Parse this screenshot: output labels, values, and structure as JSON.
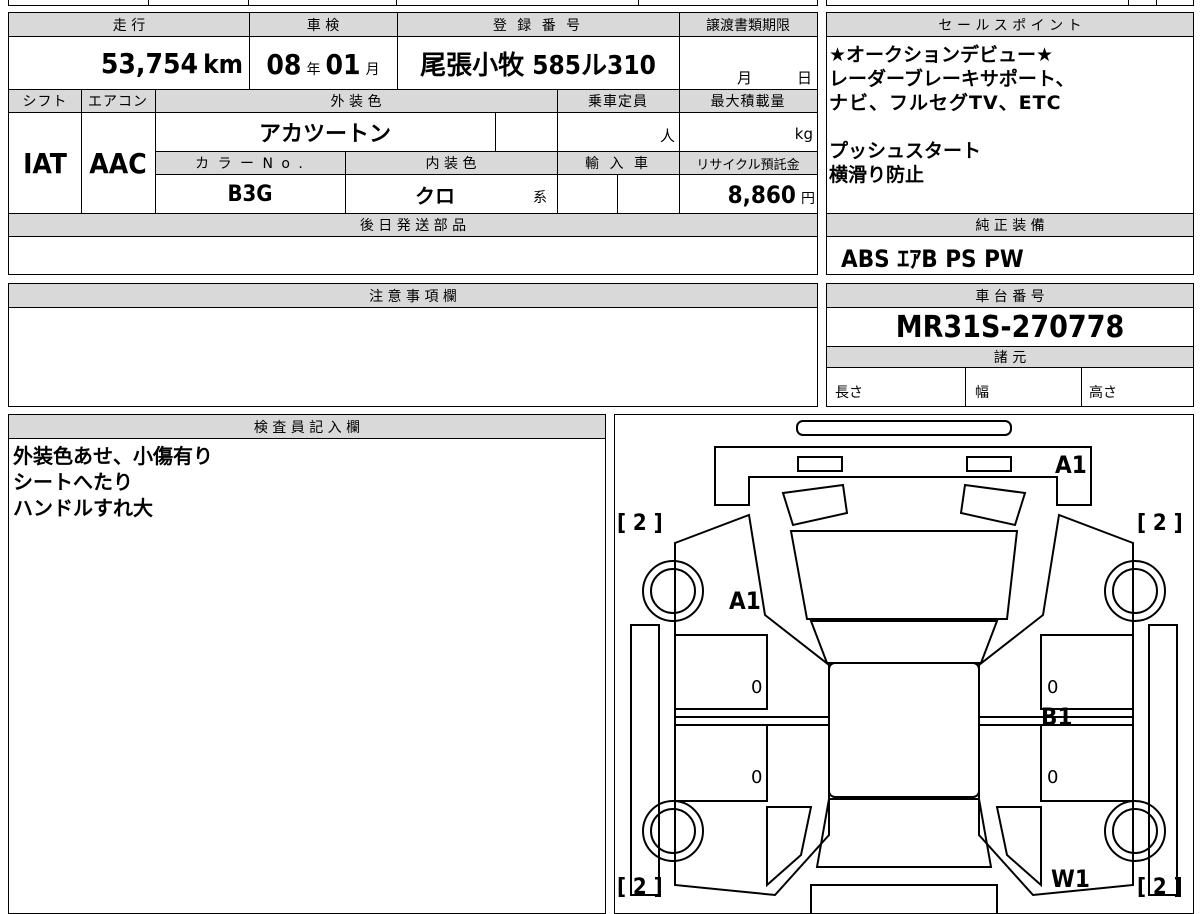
{
  "top": {
    "mileage_label": "走 行",
    "mileage_value": "53,754",
    "mileage_unit": "km",
    "shaken_label": "車 検",
    "shaken_year": "08",
    "shaken_year_unit": "年",
    "shaken_month": "01",
    "shaken_month_unit": "月",
    "reg_label": "登 録 番 号",
    "reg_value": "尾張小牧 585ル310",
    "transfer_label": "譲渡書類期限",
    "transfer_month_unit": "月",
    "transfer_day_unit": "日"
  },
  "row2": {
    "shift_label": "シフト",
    "aircon_label": "エアコン",
    "exterior_label": "外 装 色",
    "capacity_label": "乗車定員",
    "maxload_label": "最大積載量",
    "shift_value": "IAT",
    "aircon_value": "AAC",
    "exterior_value": "アカツートン",
    "capacity_unit": "人",
    "maxload_unit": "kg",
    "colorno_label": "カ ラ ー N o .",
    "interior_label": "内 装 色",
    "import_label": "輸 入 車",
    "recycle_label": "リサイクル預託金",
    "colorno_value": "B3G",
    "interior_value": "クロ",
    "interior_suffix": "系",
    "recycle_value": "8,860",
    "recycle_unit": "円"
  },
  "later_parts": {
    "label": "後 日 発 送 部 品"
  },
  "notes": {
    "label": "注 意 事 項 欄"
  },
  "inspector": {
    "label": "検 査 員 記 入 欄",
    "lines": [
      "外装色あせ、小傷有り",
      "シートへたり",
      "ハンドルすれ大"
    ]
  },
  "sales_point": {
    "label": "セ ー ル ス ポ イ ン ト",
    "lines": [
      "★オークションデビュー★",
      "レーダーブレーキサポート、",
      "ナビ、フルセグTV、ETC",
      "",
      "プッシュスタート",
      "横滑り防止"
    ]
  },
  "equipment": {
    "label": "純 正 装 備",
    "value": "ABS ｴｱB PS PW"
  },
  "chassis": {
    "label": "車 台 番 号",
    "value": "MR31S-270778"
  },
  "specs": {
    "label": "諸 元",
    "length": "長さ",
    "width": "幅",
    "height": "高さ"
  },
  "diagram": {
    "tire_fl": "[ 2 ]",
    "tire_fr": "[ 2 ]",
    "tire_rl": "[ 2 ]",
    "tire_rr": "[ 2 ]",
    "mark_a1_top": "A1",
    "mark_a1_left": "A1",
    "mark_b1": "B1",
    "mark_w1": "W1",
    "zero_1": "0",
    "zero_2": "0",
    "zero_3": "0",
    "zero_4": "0"
  }
}
